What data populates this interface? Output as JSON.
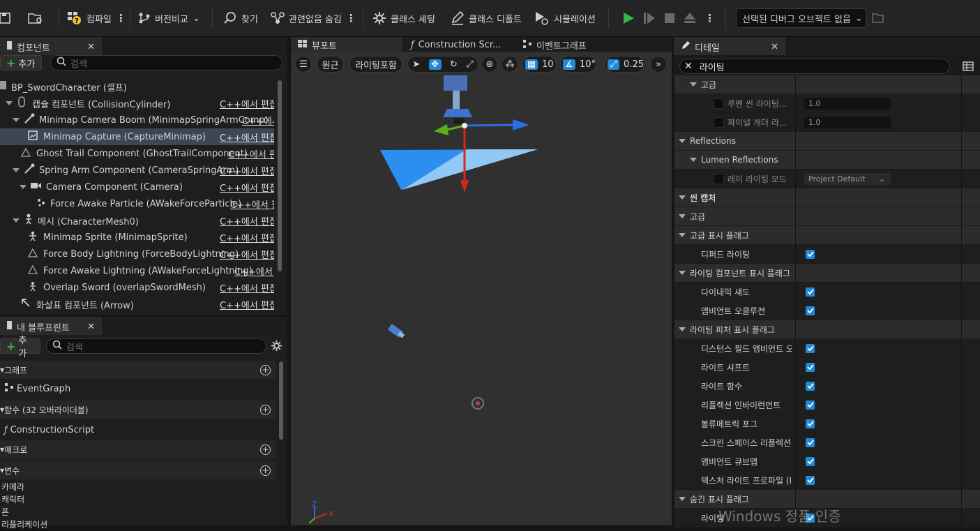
{
  "toolbar": {
    "compile": "컴파일",
    "diff": "버전비교",
    "find": "찾기",
    "hide_unrelated": "관련없음 숨김",
    "class_settings": "클래스 세팅",
    "class_defaults": "클래스 디폴트",
    "simulation": "시뮬레이션",
    "debug_object": "선택된 디버그 오브젝트 없음"
  },
  "components": {
    "tab_label": "컴포넌트",
    "add_label": "추가",
    "search_placeholder": "검색",
    "items": [
      {
        "label": "BP_SwordCharacter (셀프)",
        "edit": ""
      },
      {
        "label": "캡슐 컴포넌트 (CollisionCylinder)",
        "edit": "C++에서 편집"
      },
      {
        "label": "Minimap Camera Boom (MinimapSpringArmComp)",
        "edit": "C++에서"
      },
      {
        "label": "Minimap Capture (CaptureMinimap)",
        "edit": "C++에서 편집"
      },
      {
        "label": "Ghost Trail Component (GhostTrailComponent)",
        "edit": "C++에서 편집"
      },
      {
        "label": "Spring Arm Component (CameraSpringArm)",
        "edit": "C++에서 편집"
      },
      {
        "label": "Camera Component (Camera)",
        "edit": "C++에서 편집"
      },
      {
        "label": "Force Awake Particle (AWakeForceParticle)",
        "edit": "C++에서 편"
      },
      {
        "label": "메시 (CharacterMesh0)",
        "edit": "C++에서 편집"
      },
      {
        "label": "Minimap Sprite (MinimapSprite)",
        "edit": "C++에서 편집"
      },
      {
        "label": "Force Body Lightning (ForceBodyLightning)",
        "edit": "C++에서 편집"
      },
      {
        "label": "Force Awake Lightning (AWakeForceLightning)",
        "edit": "C++에서 편"
      },
      {
        "label": "Overlap Sword (overlapSwordMesh)",
        "edit": "C++에서 편집"
      },
      {
        "label": "화살표 컴포넌트 (Arrow)",
        "edit": "C++에서 편집"
      }
    ]
  },
  "my_blueprint": {
    "tab_label": "내 블루프린트",
    "add_label": "추가",
    "search_placeholder": "검색",
    "graph_header": "그래프",
    "event_graph": "EventGraph",
    "functions_header": "함수 (32 오버라이더블)",
    "construction_script": "ConstructionScript",
    "macros_header": "매크로",
    "variables_header": "변수",
    "variables": [
      "카메라",
      "캐릭터",
      "폰",
      "리플리케이션"
    ]
  },
  "viewport": {
    "tabs": [
      "뷰포트",
      "Construction Scr...",
      "이벤트그래프"
    ],
    "perspective": "원근",
    "lighting": "라이팅포함",
    "grid_snap": "10",
    "angle_snap": "10°",
    "scale_snap": "0.25",
    "axis_z": "Z",
    "axis_x": "X"
  },
  "details": {
    "tab_label": "디테일",
    "search_value": "라이팅",
    "rows": [
      {
        "kind": "cat",
        "depth": 1,
        "label": "고급"
      },
      {
        "kind": "num",
        "depth": 2,
        "label": "루멘 씬 라이팅...",
        "value": "1.0"
      },
      {
        "kind": "num",
        "depth": 2,
        "label": "파이널 개더 라...",
        "value": "1.0"
      },
      {
        "kind": "cat",
        "depth": 0,
        "label": "Reflections"
      },
      {
        "kind": "cat",
        "depth": 1,
        "label": "Lumen Reflections"
      },
      {
        "kind": "dropdown",
        "depth": 2,
        "label": "레이 라이팅 모드",
        "value": "Project Default"
      },
      {
        "kind": "cat",
        "depth": 0,
        "label": "씬 캡처"
      },
      {
        "kind": "cat",
        "depth": 0,
        "label": "고급"
      },
      {
        "kind": "cat",
        "depth": 0,
        "label": "고급 표시 플래그"
      },
      {
        "kind": "check",
        "depth": 1,
        "label": "디퍼드 라이팅",
        "checked": true
      },
      {
        "kind": "cat",
        "depth": 0,
        "label": "라이팅 컴포넌트 표시 플래그"
      },
      {
        "kind": "check",
        "depth": 1,
        "label": "다이내믹 섀도",
        "checked": true
      },
      {
        "kind": "check",
        "depth": 1,
        "label": "앰비언트 오클루전",
        "checked": true
      },
      {
        "kind": "cat",
        "depth": 0,
        "label": "라이팅 피처 표시 플래그"
      },
      {
        "kind": "check",
        "depth": 1,
        "label": "디스턴스 필드 앰비언트 오",
        "checked": true
      },
      {
        "kind": "check",
        "depth": 1,
        "label": "라이트 샤프트",
        "checked": true
      },
      {
        "kind": "check",
        "depth": 1,
        "label": "라이트 함수",
        "checked": true
      },
      {
        "kind": "check",
        "depth": 1,
        "label": "리플렉션 인바이런먼트",
        "checked": true
      },
      {
        "kind": "check",
        "depth": 1,
        "label": "볼류메트릭 포그",
        "checked": true
      },
      {
        "kind": "check",
        "depth": 1,
        "label": "스크린 스페이스 리플렉션",
        "checked": true
      },
      {
        "kind": "check",
        "depth": 1,
        "label": "앰비언트 큐브맵",
        "checked": true
      },
      {
        "kind": "check",
        "depth": 1,
        "label": "텍스처 라이트 프로파일 (I",
        "checked": true
      },
      {
        "kind": "cat",
        "depth": 0,
        "label": "숨긴 표시 플래그"
      },
      {
        "kind": "check",
        "depth": 1,
        "label": "라이팅",
        "checked": true
      }
    ]
  },
  "watermark": "Windows 정품 인증",
  "colors": {
    "accent": "#1f8ad8",
    "selected_row": "#3c4655",
    "play_green": "#36b34a"
  }
}
